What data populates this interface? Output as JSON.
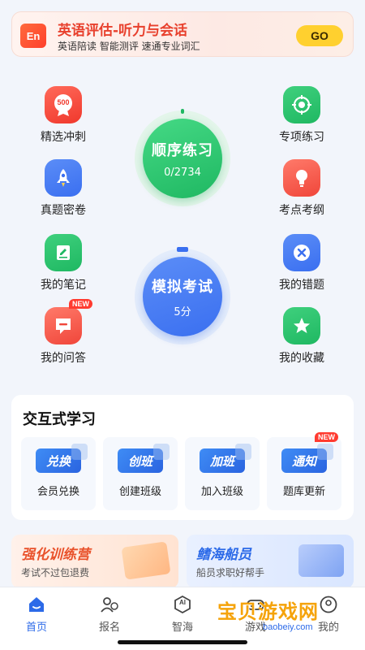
{
  "banner": {
    "logo_text": "En",
    "title": "英语评估-听力与会话",
    "subtitle": "英语陪读 智能测评 速通专业词汇",
    "go_label": "GO"
  },
  "features": {
    "jingxuan": {
      "label": "精选冲刺",
      "icon": "500-medal-icon",
      "icon_text": "500"
    },
    "zhuanxiang": {
      "label": "专项练习",
      "icon": "target-icon"
    },
    "zhenti": {
      "label": "真题密卷",
      "icon": "rocket-icon"
    },
    "kaodian": {
      "label": "考点考纲",
      "icon": "lightbulb-icon"
    },
    "biji": {
      "label": "我的笔记",
      "icon": "notebook-icon"
    },
    "cuoti": {
      "label": "我的错题",
      "icon": "x-circle-icon"
    },
    "wenda": {
      "label": "我的问答",
      "icon": "chat-bubble-icon",
      "badge": "NEW"
    },
    "shoucang": {
      "label": "我的收藏",
      "icon": "star-icon"
    }
  },
  "practice": {
    "title": "顺序练习",
    "progress": "0/2734"
  },
  "mock_exam": {
    "title": "模拟考试",
    "score": "5分"
  },
  "interactive": {
    "title": "交互式学习",
    "tiles": [
      {
        "label": "会员兑换",
        "image_text": "兑换"
      },
      {
        "label": "创建班级",
        "image_text": "创班"
      },
      {
        "label": "加入班级",
        "image_text": "加班"
      },
      {
        "label": "题库更新",
        "image_text": "通知",
        "badge": "NEW"
      }
    ]
  },
  "promos": {
    "left": {
      "title": "强化训练营",
      "subtitle": "考试不过包退费"
    },
    "right": {
      "title": "鳍海船员",
      "subtitle": "船员求职好帮手"
    }
  },
  "nav": {
    "items": [
      {
        "label": "首页",
        "icon": "home-icon"
      },
      {
        "label": "报名",
        "icon": "signup-icon"
      },
      {
        "label": "智海",
        "icon": "ai-icon",
        "icon_text": "AI"
      },
      {
        "label": "游戏",
        "icon": "gamepad-icon"
      },
      {
        "label": "我的",
        "icon": "profile-icon"
      }
    ]
  },
  "watermark": {
    "line1": "宝贝游戏网",
    "line2": "baobeiy.com"
  },
  "colors": {
    "green": "#1fb862",
    "blue": "#3a6ff0",
    "accent_red": "#ff3b30",
    "nav_active": "#2c6ae8"
  }
}
